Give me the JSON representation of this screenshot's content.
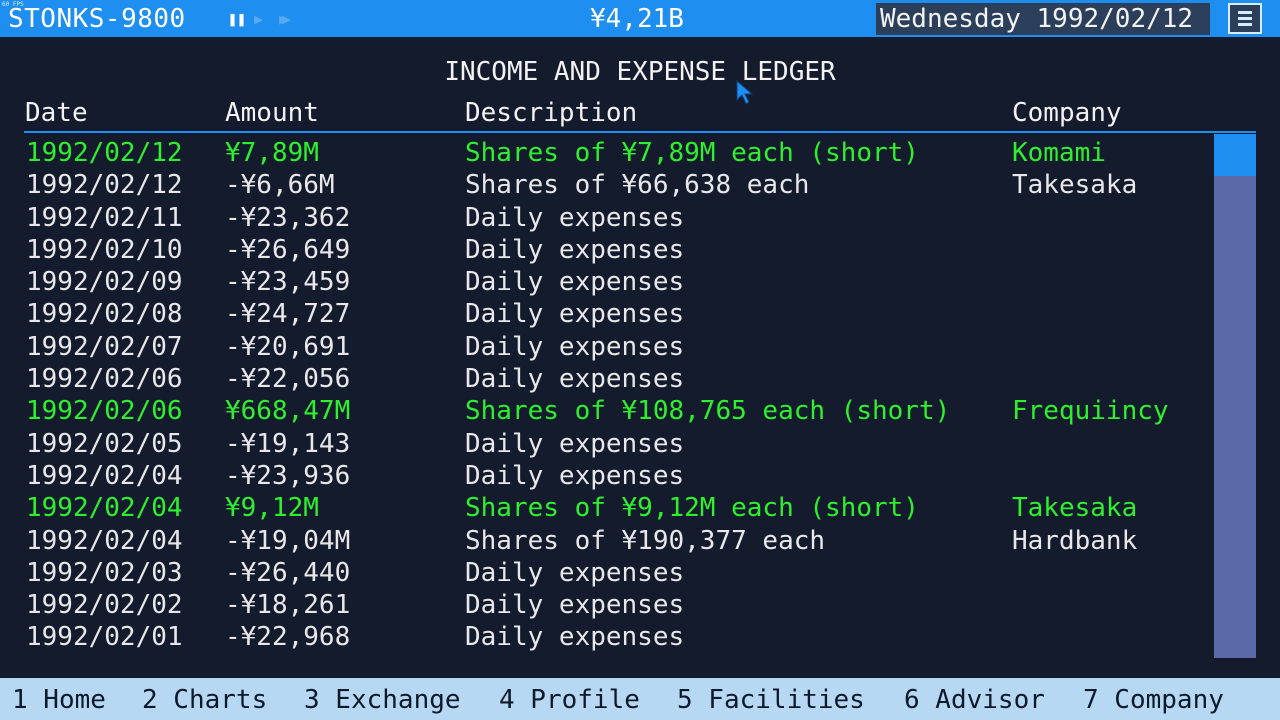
{
  "topbar": {
    "fps": "60 FPS",
    "app_title": "STONKS-9800",
    "pause_icon": "pause-icon",
    "play_icon": "play-icon",
    "fast_forward_icon": "fast-forward-icon",
    "balance": "¥4,21B",
    "current_date": "Wednesday 1992/02/12",
    "menu_icon": "hamburger-menu-icon"
  },
  "ledger": {
    "title": "INCOME AND EXPENSE LEDGER",
    "columns": {
      "date": "Date",
      "amount": "Amount",
      "description": "Description",
      "company": "Company"
    },
    "rows": [
      {
        "date": "1992/02/12",
        "amount": "¥7,89M",
        "description": "Shares of ¥7,89M each (short)",
        "company": "Komami",
        "income": true
      },
      {
        "date": "1992/02/12",
        "amount": "-¥6,66M",
        "description": "Shares of ¥66,638 each",
        "company": "Takesaka",
        "income": false
      },
      {
        "date": "1992/02/11",
        "amount": "-¥23,362",
        "description": "Daily expenses",
        "company": "",
        "income": false
      },
      {
        "date": "1992/02/10",
        "amount": "-¥26,649",
        "description": "Daily expenses",
        "company": "",
        "income": false
      },
      {
        "date": "1992/02/09",
        "amount": "-¥23,459",
        "description": "Daily expenses",
        "company": "",
        "income": false
      },
      {
        "date": "1992/02/08",
        "amount": "-¥24,727",
        "description": "Daily expenses",
        "company": "",
        "income": false
      },
      {
        "date": "1992/02/07",
        "amount": "-¥20,691",
        "description": "Daily expenses",
        "company": "",
        "income": false
      },
      {
        "date": "1992/02/06",
        "amount": "-¥22,056",
        "description": "Daily expenses",
        "company": "",
        "income": false
      },
      {
        "date": "1992/02/06",
        "amount": "¥668,47M",
        "description": "Shares of ¥108,765 each (short)",
        "company": "Frequiincy",
        "income": true
      },
      {
        "date": "1992/02/05",
        "amount": "-¥19,143",
        "description": "Daily expenses",
        "company": "",
        "income": false
      },
      {
        "date": "1992/02/04",
        "amount": "-¥23,936",
        "description": "Daily expenses",
        "company": "",
        "income": false
      },
      {
        "date": "1992/02/04",
        "amount": "¥9,12M",
        "description": "Shares of ¥9,12M each (short)",
        "company": "Takesaka",
        "income": true
      },
      {
        "date": "1992/02/04",
        "amount": "-¥19,04M",
        "description": "Shares of ¥190,377 each",
        "company": "Hardbank",
        "income": false
      },
      {
        "date": "1992/02/03",
        "amount": "-¥26,440",
        "description": "Daily expenses",
        "company": "",
        "income": false
      },
      {
        "date": "1992/02/02",
        "amount": "-¥18,261",
        "description": "Daily expenses",
        "company": "",
        "income": false
      },
      {
        "date": "1992/02/01",
        "amount": "-¥22,968",
        "description": "Daily expenses",
        "company": "",
        "income": false
      }
    ]
  },
  "bottom_nav": {
    "items": [
      {
        "label": "1 Home"
      },
      {
        "label": "2 Charts"
      },
      {
        "label": "3 Exchange"
      },
      {
        "label": "4 Profile"
      },
      {
        "label": "5 Facilities"
      },
      {
        "label": "6 Advisor"
      },
      {
        "label": "7 Company"
      }
    ]
  },
  "colors": {
    "accent_blue": "#1e8ef0",
    "background": "#141b2d",
    "income_green": "#2ef02e",
    "expense_text": "#e8e8ea",
    "scrollbar_track": "#5a6aa8",
    "nav_bar": "#b7d8f2"
  }
}
